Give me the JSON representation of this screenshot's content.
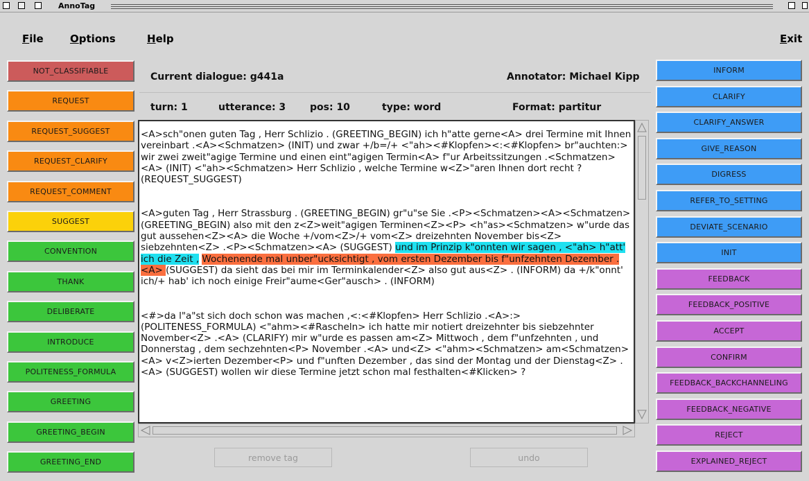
{
  "window": {
    "title": "AnnoTag"
  },
  "menu": {
    "file": "File",
    "options": "Options",
    "help": "Help",
    "exit": "Exit"
  },
  "header": {
    "dialogue": "Current dialogue: g441a",
    "annotator": "Annotator: Michael Kipp",
    "turn": "turn: 1",
    "utterance": "utterance: 3",
    "pos": "pos: 10",
    "type": "type: word",
    "format": "Format: partitur"
  },
  "left_buttons": [
    {
      "label": "NOT_CLASSIFIABLE",
      "color": "#cc5b5b"
    },
    {
      "label": "REQUEST",
      "color": "#f98a12"
    },
    {
      "label": "REQUEST_SUGGEST",
      "color": "#f98a12"
    },
    {
      "label": "REQUEST_CLARIFY",
      "color": "#f98a12"
    },
    {
      "label": "REQUEST_COMMENT",
      "color": "#f98a12"
    },
    {
      "label": "SUGGEST",
      "color": "#fbd10a"
    },
    {
      "label": "CONVENTION",
      "color": "#3cc63c"
    },
    {
      "label": "THANK",
      "color": "#3cc63c"
    },
    {
      "label": "DELIBERATE",
      "color": "#3cc63c"
    },
    {
      "label": "INTRODUCE",
      "color": "#3cc63c"
    },
    {
      "label": "POLITENESS_FORMULA",
      "color": "#3cc63c"
    },
    {
      "label": "GREETING",
      "color": "#3cc63c"
    },
    {
      "label": "GREETING_BEGIN",
      "color": "#3cc63c"
    },
    {
      "label": "GREETING_END",
      "color": "#3cc63c"
    }
  ],
  "right_buttons": [
    {
      "label": "INFORM",
      "color": "#3e9cf6"
    },
    {
      "label": "CLARIFY",
      "color": "#3e9cf6"
    },
    {
      "label": "CLARIFY_ANSWER",
      "color": "#3e9cf6"
    },
    {
      "label": "GIVE_REASON",
      "color": "#3e9cf6"
    },
    {
      "label": "DIGRESS",
      "color": "#3e9cf6"
    },
    {
      "label": "REFER_TO_SETTING",
      "color": "#3e9cf6"
    },
    {
      "label": "DEVIATE_SCENARIO",
      "color": "#3e9cf6"
    },
    {
      "label": "INIT",
      "color": "#3e9cf6"
    },
    {
      "label": "FEEDBACK",
      "color": "#c667d6"
    },
    {
      "label": "FEEDBACK_POSITIVE",
      "color": "#c667d6"
    },
    {
      "label": "ACCEPT",
      "color": "#c667d6"
    },
    {
      "label": "CONFIRM",
      "color": "#c667d6"
    },
    {
      "label": "FEEDBACK_BACKCHANNELING",
      "color": "#c667d6"
    },
    {
      "label": "FEEDBACK_NEGATIVE",
      "color": "#c667d6"
    },
    {
      "label": "REJECT",
      "color": "#c667d6"
    },
    {
      "label": "EXPLAINED_REJECT",
      "color": "#c667d6"
    }
  ],
  "transcript": {
    "p1": "<A>sch\"onen guten Tag , Herr Schlizio .  (GREETING_BEGIN) ich h\"atte gerne<A> drei Termine mit Ihnen vereinbart .<A><Schmatzen>  (INIT) und zwar +/b=/+ <\"ah><#Klopfen><:<#Klopfen> br\"auchten:> wir zwei zweit\"agige Termine und einen eint\"agigen Termin<A> f\"ur Arbeitssitzungen .<Schmatzen><A>  (INIT) <\"ah><Schmatzen> Herr Schlizio , welche Termine w<Z>\"aren Ihnen dort recht ?  (REQUEST_SUGGEST)",
    "p2_a": "<A>guten Tag , Herr Strassburg .  (GREETING_BEGIN) gr\"u\"se Sie .<P><Schmatzen><A><Schmatzen>  (GREETING_BEGIN) also mit den z<Z>weit\"agigen Terminen<Z><P> <h\"as><Schmatzen> w\"urde das gut aussehen<Z><A> die Woche +/vom<Z>/+ vom<Z> dreizehnten November bis<Z> siebzehnten<Z> .<P><Schmatzen><A>  (SUGGEST) ",
    "p2_hl1": "und im Prinzip k\"onnten wir sagen , <\"ah> h\"att' ich die Zeit ,",
    "p2_sp": " ",
    "p2_hl2": "Wochenende mal unber\"ucksichtigt , vom ersten Dezember bis f\"unfzehnten Dezember .<A> ",
    "p2_b": " (SUGGEST) da sieht das bei mir im Terminkalender<Z> also gut aus<Z> .  (INFORM) da +/k\"onnt' ich/+ hab' ich noch einige Freir\"aume<Ger\"ausch> .  (INFORM)",
    "p3": "<#>da l\"a\"st sich doch schon was machen ,<:<#Klopfen> Herr Schlizio .<A>:>  (POLITENESS_FORMULA) <\"ahm><#Rascheln> ich hatte mir notiert dreizehnter bis siebzehnter November<Z> .<A>  (CLARIFY) mir w\"urde es passen am<Z> Mittwoch , dem f\"unfzehnten , und Donnerstag , dem sechzehnten<P> November .<A> und<Z> <\"ahm><Schmatzen> am<Schmatzen><A> v<Z>ierten Dezember<P> und f\"unften Dezember , das sind der Montag und der Dienstag<Z> .<A>  (SUGGEST) wollen wir diese Termine jetzt schon mal festhalten<#Klicken> ?"
  },
  "actions": {
    "remove_tag": "remove tag",
    "undo": "undo"
  }
}
